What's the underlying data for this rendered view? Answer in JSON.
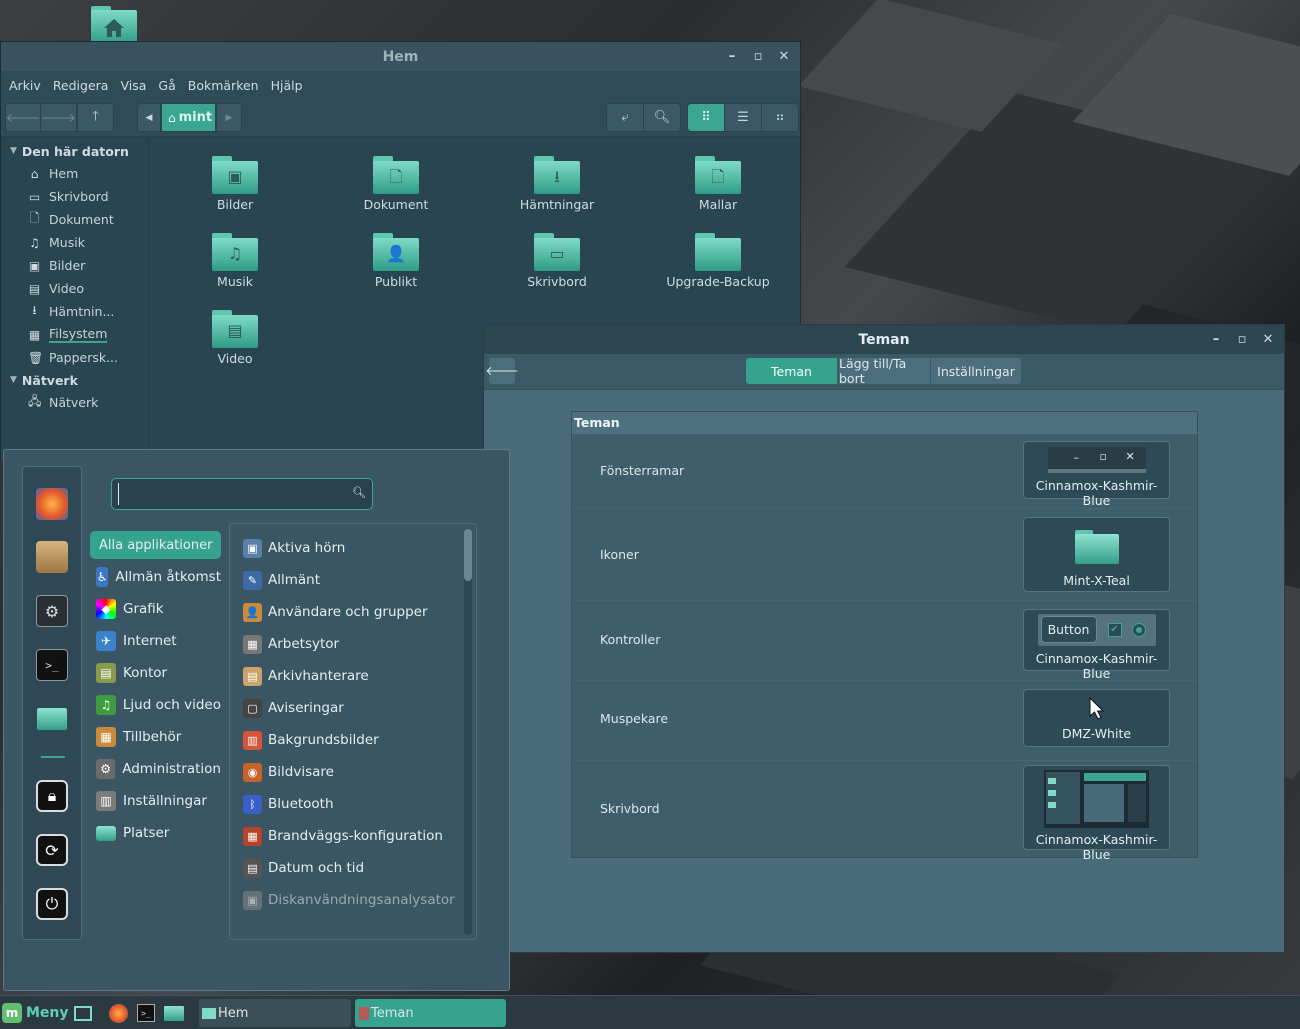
{
  "desktop": {
    "home_icon": "home-folder-icon"
  },
  "file_manager": {
    "title": "Hem",
    "menu": [
      "Arkiv",
      "Redigera",
      "Visa",
      "Gå",
      "Bokmärken",
      "Hjälp"
    ],
    "path": "mint",
    "sidebar": {
      "section_computer": "Den här datorn",
      "computer_items": [
        {
          "label": "Hem",
          "icon": "home-icon"
        },
        {
          "label": "Skrivbord",
          "icon": "desktop-icon"
        },
        {
          "label": "Dokument",
          "icon": "document-icon"
        },
        {
          "label": "Musik",
          "icon": "music-icon"
        },
        {
          "label": "Bilder",
          "icon": "pictures-icon"
        },
        {
          "label": "Video",
          "icon": "video-icon"
        },
        {
          "label": "Hämtnin...",
          "icon": "download-icon"
        },
        {
          "label": "Filsystem",
          "icon": "filesystem-icon"
        },
        {
          "label": "Pappersk...",
          "icon": "trash-icon"
        }
      ],
      "section_network": "Nätverk",
      "network_items": [
        {
          "label": "Nätverk",
          "icon": "network-icon"
        }
      ]
    },
    "files": [
      "Bilder",
      "Dokument",
      "Hämtningar",
      "Mallar",
      "Musik",
      "Publikt",
      "Skrivbord",
      "Upgrade-Backup",
      "Video"
    ]
  },
  "themes": {
    "title": "Teman",
    "tabs": [
      "Teman",
      "Lägg till/Ta bort",
      "Inställningar"
    ],
    "panel_title": "Teman",
    "rows": [
      {
        "label": "Fönsterramar",
        "value": "Cinnamox-Kashmir-Blue"
      },
      {
        "label": "Ikoner",
        "value": "Mint-X-Teal"
      },
      {
        "label": "Kontroller",
        "value": "Cinnamox-Kashmir-Blue",
        "button_label": "Button"
      },
      {
        "label": "Muspekare",
        "value": "DMZ-White"
      },
      {
        "label": "Skrivbord",
        "value": "Cinnamox-Kashmir-Blue"
      }
    ]
  },
  "app_menu": {
    "search_placeholder": "",
    "categories": [
      "Alla applikationer",
      "Allmän åtkomst",
      "Grafik",
      "Internet",
      "Kontor",
      "Ljud och video",
      "Tillbehör",
      "Administration",
      "Inställningar",
      "Platser"
    ],
    "apps": [
      "Aktiva hörn",
      "Allmänt",
      "Användare och grupper",
      "Arbetsytor",
      "Arkivhanterare",
      "Aviseringar",
      "Bakgrundsbilder",
      "Bildvisare",
      "Bluetooth",
      "Brandväggs-konfiguration",
      "Datum och tid",
      "Diskanvändningsanalysator"
    ]
  },
  "taskbar": {
    "menu_label": "Meny",
    "windows": [
      "Hem",
      "Teman"
    ]
  }
}
